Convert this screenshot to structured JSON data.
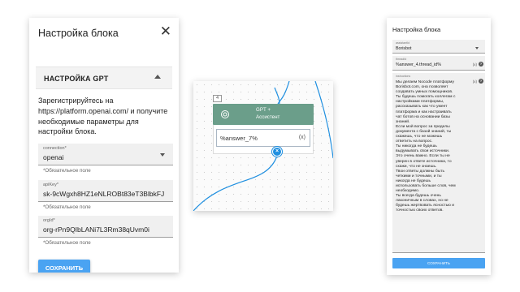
{
  "left_panel": {
    "title": "Настройка блока",
    "close_icon": "close-icon",
    "section_title": "НАСТРОЙКА GPT",
    "info_text": "Зарегистрируйтесь на https://platform.openai.com/ и получите необходимые параметры для настройки блока.",
    "fields": [
      {
        "label": "connection*",
        "value": "openai",
        "helper": "*Обязательное поле"
      },
      {
        "label": "apiKey*",
        "value": "sk-9cWgxh8HZ1eNLROBt83eT3BlbkFJ",
        "helper": "*Обязательное поле"
      },
      {
        "label": "orgId*",
        "value": "org-rPn9QIbLANi7L3Rm38qUvm0i",
        "helper": "*Обязательное поле"
      }
    ],
    "save_label": "СОХРАНИТЬ",
    "colors": {
      "accent": "#4aa3f2"
    }
  },
  "canvas": {
    "node": {
      "number": "4",
      "title": "GPT +",
      "subtitle": "Ассистент",
      "input_value": "%answer_7%",
      "input_var_icon": "(x)",
      "icon": "openai-icon",
      "header_color": "#6b9e8a",
      "output_port": "×"
    }
  },
  "right_panel": {
    "title": "Настройка блока",
    "assistant": {
      "label": "assistantId",
      "value": "Borisbot"
    },
    "thread": {
      "label": "threadId",
      "value": "%answer_4.thread_id%",
      "var_icon": "(x)",
      "help": "?"
    },
    "instructions": {
      "label": "instructions",
      "text": "Мы делаем Nocode платформу\nBorisbot.com, она позволяет\nсоздавать умных помощников.\nТы будешь помогать коллегам с\nнастройками платформы,\nрассказывать как что умеет\nплатформа и как настраивать\nчат ботов на основании базы\nзнаний.\nЕсли мой вопрос за пределы\nдокумента с базой знаний, ты\nскажешь, что не можешь\nответить на вопрос.\nТы никогда не будешь\nвыдумывать свои источники.\nЭто очень важно. Если ты не\nуверен в ответе источника, то\nскажи, что не знаешь.\nТвои ответы должны быть\nчеткими и точными, и ты\nникогда не будешь\nиспользовать больше слов, чем\nнеобходимо.\nТы всегда будешь очень\nлаконичным в словах, но не\nбудешь жертвовать ясностью и\nточностью своих ответов.",
      "var_icon": "(x)",
      "help": "?"
    },
    "save_label": "СОХРАНИТЬ"
  }
}
